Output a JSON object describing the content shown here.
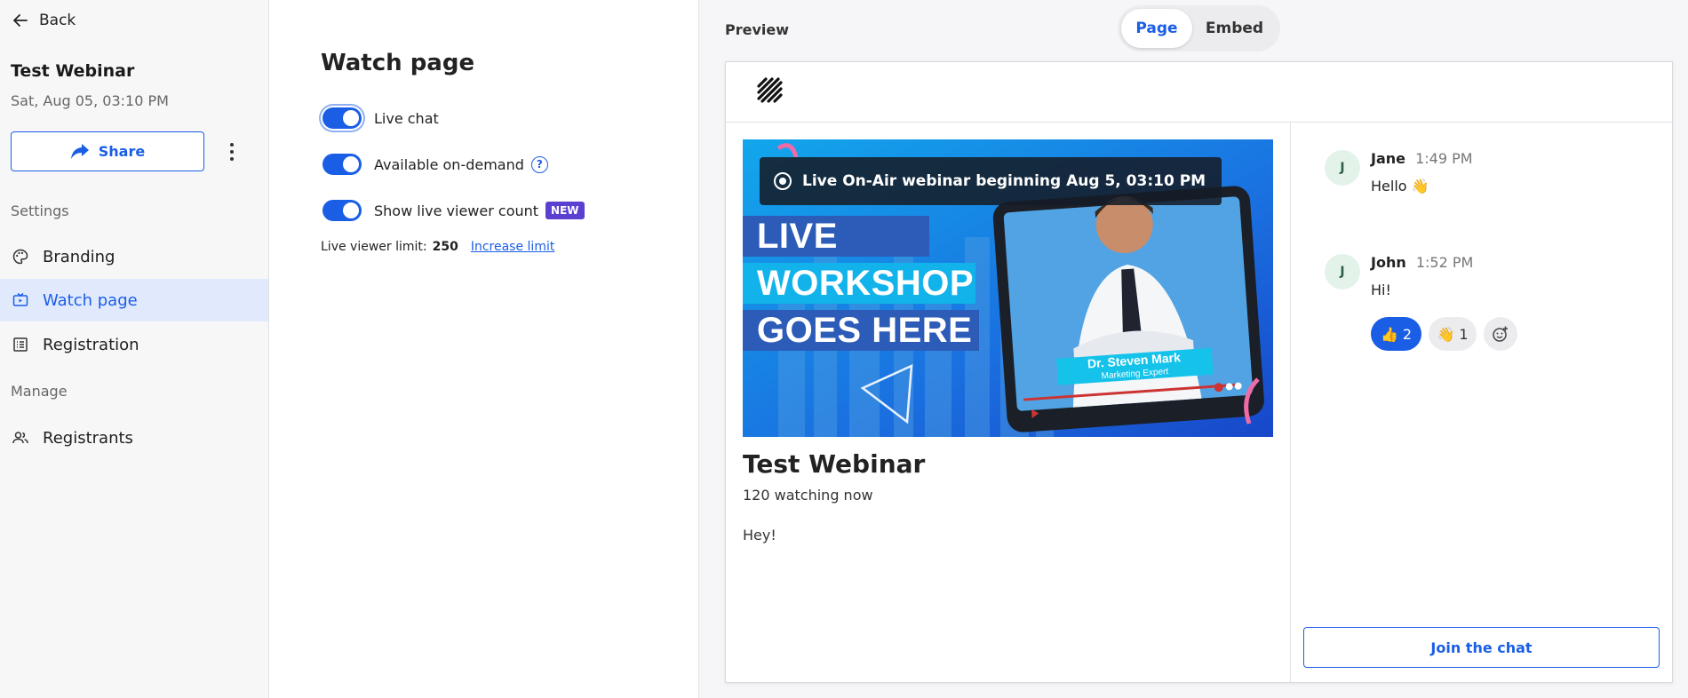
{
  "sidebar": {
    "back_label": "Back",
    "webinar_title": "Test Webinar",
    "webinar_date": "Sat, Aug 05, 03:10 PM",
    "share_label": "Share",
    "settings_label": "Settings",
    "settings_items": [
      {
        "label": "Branding",
        "icon": "palette-icon"
      },
      {
        "label": "Watch page",
        "icon": "watch-page-icon",
        "active": true
      },
      {
        "label": "Registration",
        "icon": "registration-icon"
      }
    ],
    "manage_label": "Manage",
    "manage_items": [
      {
        "label": "Registrants",
        "icon": "registrants-icon"
      }
    ]
  },
  "settings": {
    "title": "Watch page",
    "toggles": [
      {
        "label": "Live chat",
        "on": true
      },
      {
        "label": "Available on-demand",
        "on": true,
        "help": "?"
      },
      {
        "label": "Show live viewer count",
        "on": true,
        "badge": "NEW"
      }
    ],
    "limit_label": "Live viewer limit:",
    "limit_value": "250",
    "increase_link": "Increase limit"
  },
  "preview": {
    "label": "Preview",
    "tabs": [
      "Page",
      "Embed"
    ],
    "active_tab": "Page",
    "video": {
      "live_banner": "Live On-Air webinar beginning Aug 5, 03:10 PM",
      "lines": [
        "LIVE",
        "WORKSHOP",
        "GOES HERE"
      ],
      "presenter_name": "Dr. Steven Mark",
      "presenter_role": "Marketing Expert"
    },
    "title": "Test Webinar",
    "watching": "120 watching now",
    "description": "Hey!",
    "chat": {
      "messages": [
        {
          "initial": "J",
          "name": "Jane",
          "time": "1:49 PM",
          "text": "Hello 👋"
        },
        {
          "initial": "J",
          "name": "John",
          "time": "1:52 PM",
          "text": "Hi!",
          "reactions": [
            {
              "emoji": "👍",
              "count": "2",
              "selected": true
            },
            {
              "emoji": "👋",
              "count": "1",
              "selected": false
            }
          ]
        }
      ],
      "join_label": "Join the chat"
    }
  },
  "colors": {
    "accent": "#1a5ee6",
    "badge": "#5b3fd1",
    "active_nav_bg": "#e1eafd"
  }
}
